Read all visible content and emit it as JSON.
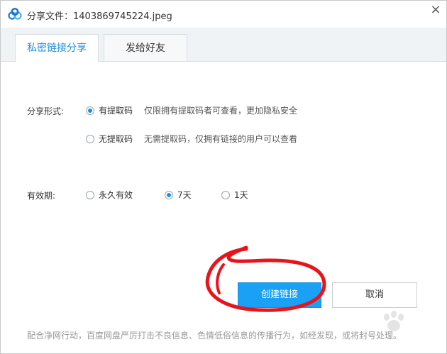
{
  "window": {
    "title_prefix": "分享文件：",
    "file_name": "1403869745224.jpeg",
    "close_glyph": "×"
  },
  "tabs": [
    {
      "label": "私密链接分享",
      "active": true
    },
    {
      "label": "发给好友",
      "active": false
    }
  ],
  "share_form": {
    "label": "分享形式:",
    "options": [
      {
        "label": "有提取码",
        "description": "仅限拥有提取码者可查看，更加隐私安全",
        "checked": true
      },
      {
        "label": "无提取码",
        "description": "无需提取码，仅拥有链接的用户可以查看",
        "checked": false
      }
    ]
  },
  "validity": {
    "label": "有效期:",
    "options": [
      {
        "label": "永久有效",
        "checked": false
      },
      {
        "label": "7天",
        "checked": true
      },
      {
        "label": "1天",
        "checked": false
      }
    ]
  },
  "buttons": {
    "create_label": "创建链接",
    "cancel_label": "取消"
  },
  "footer_note": "配合净网行动，百度网盘严厉打击不良信息、色情低俗信息的传播行为，如经发现，或将封号处理。",
  "colors": {
    "accent": "#1e8ee3",
    "primary_button": "#1aa0f5",
    "annotation_stroke": "#e8141c"
  }
}
